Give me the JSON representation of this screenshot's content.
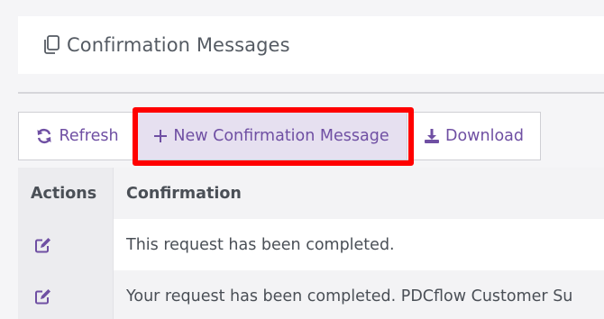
{
  "header": {
    "title": "Confirmation Messages",
    "title_icon": "copy-icon"
  },
  "toolbar": {
    "refresh_label": "Refresh",
    "refresh_icon": "refresh-icon",
    "new_label": "New Confirmation Message",
    "new_icon": "plus-icon",
    "download_label": "Download",
    "download_icon": "download-icon"
  },
  "table": {
    "columns": [
      "Actions",
      "Confirmation"
    ],
    "rows": [
      {
        "action_icon": "edit-icon",
        "confirmation": "This request has been completed."
      },
      {
        "action_icon": "edit-icon",
        "confirmation": "Your request has been completed. PDCflow Customer Su"
      }
    ]
  },
  "colors": {
    "accent": "#6f4fa3",
    "highlight": "#ff0000",
    "new_button_bg": "#e6e0f0"
  }
}
